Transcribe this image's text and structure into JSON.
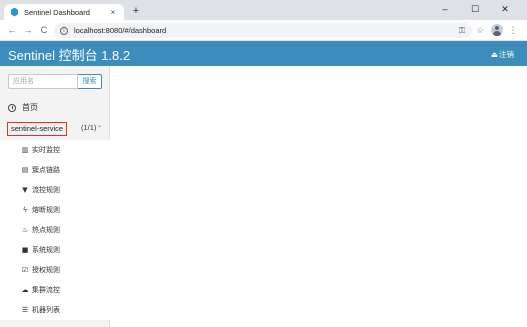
{
  "browser": {
    "tab_title": "Sentinel Dashboard",
    "tab_close": "×",
    "new_tab": "+",
    "minimize": "–",
    "maximize": "☐",
    "close": "✕",
    "back": "←",
    "forward": "→",
    "reload": "C",
    "info": "i",
    "url": "localhost:8080/#/dashboard",
    "key_icon": "⚿",
    "star_icon": "☆",
    "menu_dots": "⋮"
  },
  "header": {
    "title": "Sentinel 控制台 1.8.2",
    "logout_icon": "⏏",
    "logout_label": "注销",
    "color": "#3c8dbc"
  },
  "sidebar": {
    "search_placeholder": "应用名",
    "search_button": "搜索",
    "home_label": "首页",
    "app_name": "sentinel-service",
    "app_count": "(1/1)",
    "app_chevron": "⌄",
    "menu": [
      {
        "icon": "bar-chart-icon",
        "glyph": "▥",
        "label": "实时监控"
      },
      {
        "icon": "list-icon",
        "glyph": "▤",
        "label": "簇点链路"
      },
      {
        "icon": "filter-icon",
        "glyph": "▼",
        "label": "流控规则"
      },
      {
        "icon": "bolt-icon",
        "glyph": "ϟ",
        "label": "熔断规则"
      },
      {
        "icon": "fire-icon",
        "glyph": "♨",
        "label": "热点规则"
      },
      {
        "icon": "lock-icon",
        "glyph": "■",
        "label": "系统规则"
      },
      {
        "icon": "check-icon",
        "glyph": "☑",
        "label": "授权规则"
      },
      {
        "icon": "cloud-icon",
        "glyph": "☁",
        "label": "集群流控"
      },
      {
        "icon": "th-list-icon",
        "glyph": "☰",
        "label": "机器列表"
      }
    ]
  }
}
